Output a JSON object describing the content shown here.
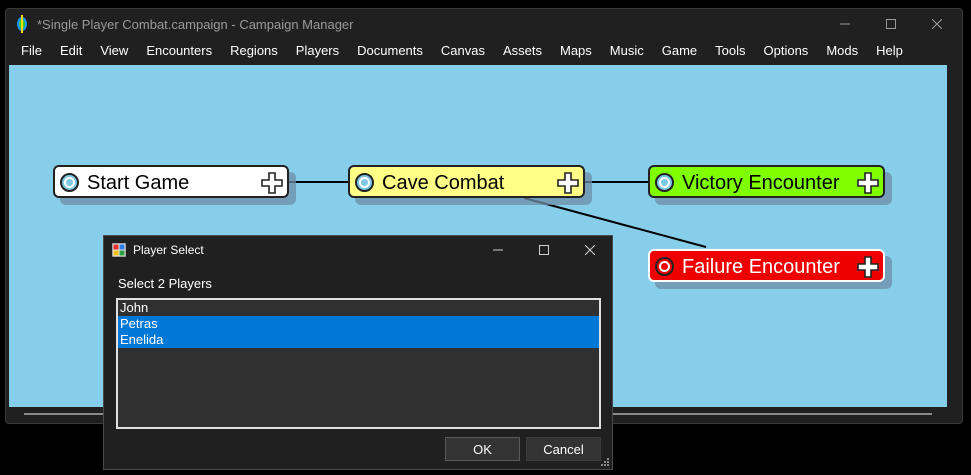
{
  "window": {
    "title": "*Single Player Combat.campaign - Campaign Manager"
  },
  "menu": [
    {
      "label": "File"
    },
    {
      "label": "Edit"
    },
    {
      "label": "View"
    },
    {
      "label": "Encounters"
    },
    {
      "label": "Regions"
    },
    {
      "label": "Players"
    },
    {
      "label": "Documents"
    },
    {
      "label": "Canvas"
    },
    {
      "label": "Assets"
    },
    {
      "label": "Maps"
    },
    {
      "label": "Music"
    },
    {
      "label": "Game"
    },
    {
      "label": "Tools"
    },
    {
      "label": "Options"
    },
    {
      "label": "Mods"
    },
    {
      "label": "Help"
    }
  ],
  "nodes": {
    "start": {
      "label": "Start Game",
      "color": "#ffffff"
    },
    "cave": {
      "label": "Cave Combat",
      "color": "#ffff88"
    },
    "victory": {
      "label": "Victory Encounter",
      "color": "#7fff00"
    },
    "failure": {
      "label": "Failure Encounter",
      "color": "#ee0000"
    }
  },
  "colors": {
    "canvas": "#87ceeb",
    "selection": "#0078d7",
    "dark_bg": "#202020"
  },
  "dialog": {
    "title": "Player Select",
    "prompt": "Select 2 Players",
    "items": [
      {
        "label": "John",
        "selected": false
      },
      {
        "label": "Petras",
        "selected": true
      },
      {
        "label": "Enelida",
        "selected": true
      }
    ],
    "ok_label": "OK",
    "cancel_label": "Cancel"
  }
}
